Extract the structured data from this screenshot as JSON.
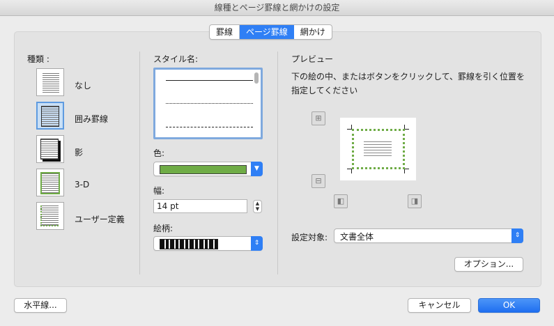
{
  "window": {
    "title": "線種とページ罫線と網かけの設定"
  },
  "tabs": [
    {
      "label": "罫線",
      "active": false
    },
    {
      "label": "ページ罫線",
      "active": true
    },
    {
      "label": "網かけ",
      "active": false
    }
  ],
  "kinds": {
    "heading": "種類 :",
    "items": [
      {
        "label": "なし",
        "icon": "none-border-icon"
      },
      {
        "label": "囲み罫線",
        "icon": "box-border-icon",
        "selected": true
      },
      {
        "label": "影",
        "icon": "shadow-border-icon"
      },
      {
        "label": "3-D",
        "icon": "3d-border-icon"
      },
      {
        "label": "ユーザー定義",
        "icon": "custom-border-icon"
      }
    ]
  },
  "style": {
    "heading": "スタイル名:",
    "color_label": "色:",
    "color_value": "#6fac46",
    "width_label": "幅:",
    "width_value": "14 pt",
    "pattern_label": "絵柄:"
  },
  "preview": {
    "heading": "プレビュー",
    "description": "下の絵の中、またはボタンをクリックして、罫線を引く位置を指定してください",
    "apply_label": "設定対象:",
    "apply_value": "文書全体",
    "options_button": "オプション..."
  },
  "footer": {
    "horizontal_line_button": "水平線...",
    "cancel_button": "キャンセル",
    "ok_button": "OK"
  },
  "colors": {
    "accent": "#2f7ff5",
    "border_green": "#6fac46"
  }
}
